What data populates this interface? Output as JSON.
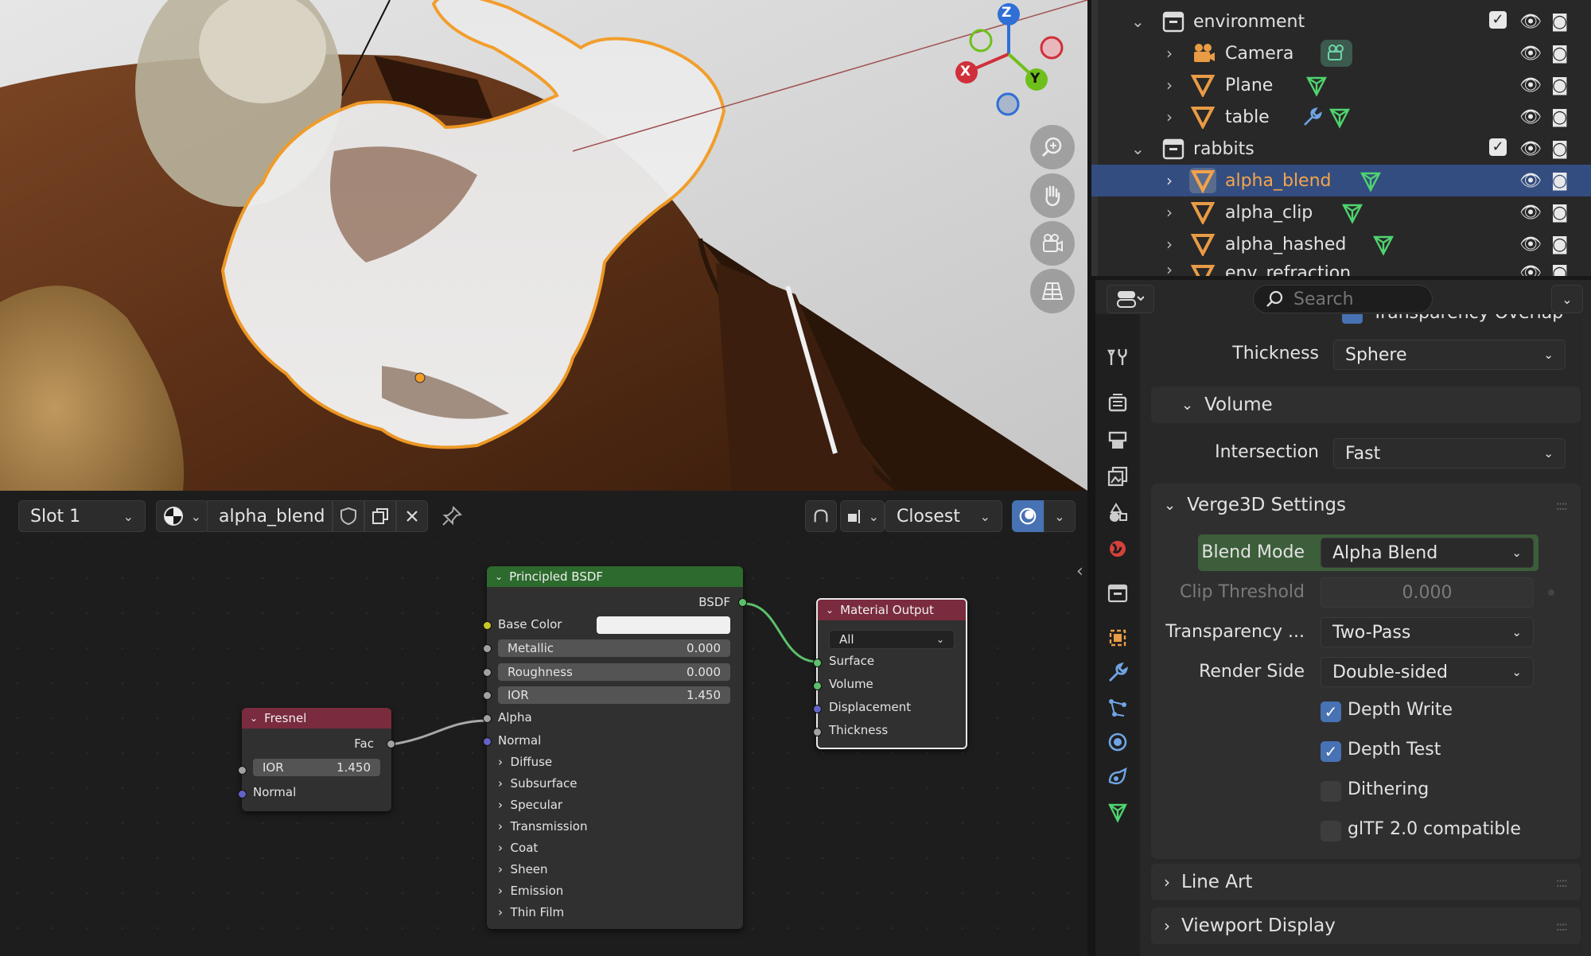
{
  "viewport": {
    "gizmo": {
      "x": "X",
      "y": "Y",
      "z": "Z"
    },
    "nav_icons": [
      "zoom-icon",
      "hand-pan-icon",
      "camera-view-icon",
      "grid-perspective-icon"
    ]
  },
  "node_header": {
    "slot": "Slot 1",
    "material": "alpha_blend",
    "interp": "Closest"
  },
  "nodes": {
    "fresnel": {
      "title": "Fresnel",
      "out": "Fac",
      "ior_label": "IOR",
      "ior_value": "1.450",
      "normal": "Normal"
    },
    "bsdf": {
      "title": "Principled BSDF",
      "out": "BSDF",
      "base_color": "Base Color",
      "metallic": {
        "label": "Metallic",
        "value": "0.000"
      },
      "roughness": {
        "label": "Roughness",
        "value": "0.000"
      },
      "ior": {
        "label": "IOR",
        "value": "1.450"
      },
      "alpha": "Alpha",
      "normal": "Normal",
      "panels": [
        "Diffuse",
        "Subsurface",
        "Specular",
        "Transmission",
        "Coat",
        "Sheen",
        "Emission",
        "Thin Film"
      ]
    },
    "output": {
      "title": "Material Output",
      "target": "All",
      "inputs": [
        "Surface",
        "Volume",
        "Displacement",
        "Thickness"
      ]
    }
  },
  "outliner": {
    "rows": [
      {
        "name": "environment",
        "kind": "collection"
      },
      {
        "name": "Camera",
        "kind": "camera"
      },
      {
        "name": "Plane",
        "kind": "mesh"
      },
      {
        "name": "table",
        "kind": "mesh"
      },
      {
        "name": "rabbits",
        "kind": "collection"
      },
      {
        "name": "alpha_blend",
        "kind": "mesh",
        "selected": true
      },
      {
        "name": "alpha_clip",
        "kind": "mesh"
      },
      {
        "name": "alpha_hashed",
        "kind": "mesh"
      },
      {
        "name": "env_refraction",
        "kind": "mesh"
      }
    ]
  },
  "properties": {
    "search_placeholder": "Search",
    "partial_label": "Transparency Overlap",
    "thickness": {
      "label": "Thickness",
      "value": "Sphere"
    },
    "volume": {
      "title": "Volume",
      "intersection_label": "Intersection",
      "intersection_value": "Fast"
    },
    "verge": {
      "title": "Verge3D Settings",
      "blend_mode": {
        "label": "Blend Mode",
        "value": "Alpha Blend"
      },
      "clip": {
        "label": "Clip Threshold",
        "value": "0.000"
      },
      "transparency": {
        "label": "Transparency ...",
        "value": "Two-Pass"
      },
      "render_side": {
        "label": "Render Side",
        "value": "Double-sided"
      },
      "checks": [
        {
          "label": "Depth Write",
          "checked": true
        },
        {
          "label": "Depth Test",
          "checked": true
        },
        {
          "label": "Dithering",
          "checked": false
        },
        {
          "label": "glTF 2.0 compatible",
          "checked": false
        }
      ]
    },
    "line_art": "Line Art",
    "viewport_display": "Viewport Display"
  },
  "colors": {
    "accent": "#4772b3",
    "selection": "#334d80",
    "orange": "#f39c26",
    "bsdf_header": "#2d6a2d",
    "output_header": "#7a2b3d"
  }
}
